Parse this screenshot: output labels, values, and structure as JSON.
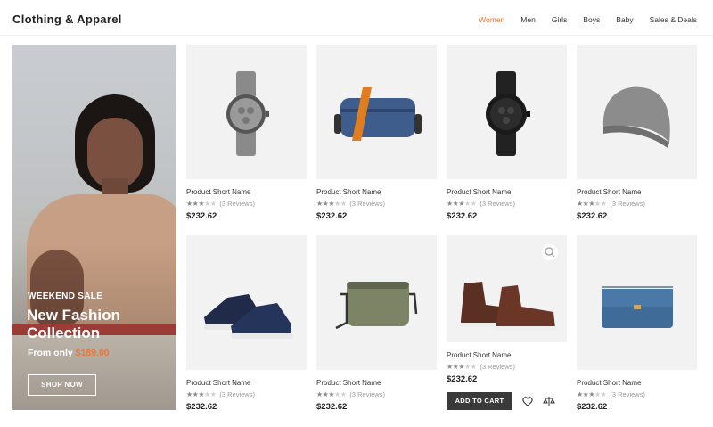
{
  "header": {
    "brand": "Clothing & Apparel",
    "nav": [
      "Women",
      "Men",
      "Girls",
      "Boys",
      "Baby",
      "Sales & Deals"
    ],
    "active_nav": "Women"
  },
  "hero": {
    "eyebrow": "WEEKEND SALE",
    "title": "New Fashion Collection",
    "from_text": "From only",
    "from_price": "$189.00",
    "button": "SHOP NOW"
  },
  "colors": {
    "accent": "#e0763a",
    "price_accent": "#f0752f",
    "button_dark": "#3a3a3a"
  },
  "products": [
    {
      "name": "Product Short Name",
      "rating": 3,
      "reviews": "(3 Reviews)",
      "price": "$232.62",
      "image_icon": "watch-gray-icon"
    },
    {
      "name": "Product Short Name",
      "rating": 3,
      "reviews": "(3 Reviews)",
      "price": "$232.62",
      "image_icon": "crossbody-bag-blue-icon"
    },
    {
      "name": "Product Short Name",
      "rating": 3,
      "reviews": "(3 Reviews)",
      "price": "$232.62",
      "image_icon": "watch-black-icon"
    },
    {
      "name": "Product Short Name",
      "rating": 3,
      "reviews": "(3 Reviews)",
      "price": "$232.62",
      "image_icon": "beanie-icon"
    },
    {
      "name": "Product Short Name",
      "rating": 3,
      "reviews": "(3 Reviews)",
      "price": "$232.62",
      "image_icon": "sneakers-icon"
    },
    {
      "name": "Product Short Name",
      "rating": 3,
      "reviews": "(3 Reviews)",
      "price": "$232.62",
      "image_icon": "camera-bag-green-icon"
    },
    {
      "name": "Product Short Name",
      "rating": 3,
      "reviews": "(3 Reviews)",
      "price": "$232.62",
      "image_icon": "boots-brown-icon"
    },
    {
      "name": "Product Short Name",
      "rating": 3,
      "reviews": "(3 Reviews)",
      "price": "$232.62",
      "image_icon": "clutch-blue-icon"
    }
  ],
  "hover_card": {
    "add_to_cart": "ADD TO CART"
  }
}
